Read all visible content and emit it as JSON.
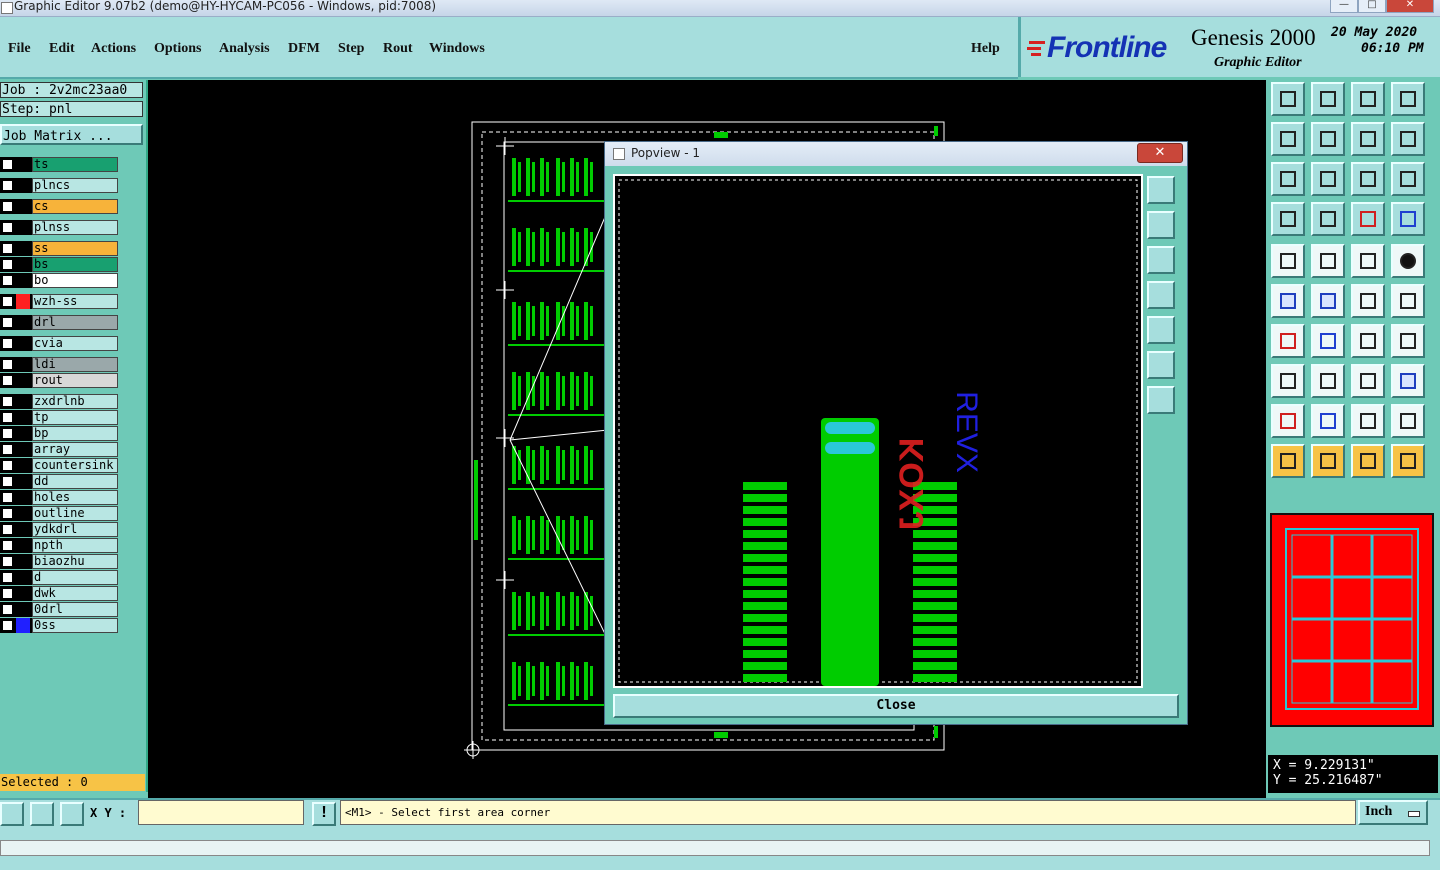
{
  "window": {
    "title": "Graphic Editor 9.07b2 (demo@HY-HYCAM-PC056 - Windows, pid:7008)",
    "min": "—",
    "max": "□",
    "close": "✕"
  },
  "menu": [
    "File",
    "Edit",
    "Actions",
    "Options",
    "Analysis",
    "DFM",
    "Step",
    "Rout",
    "Windows"
  ],
  "help": "Help",
  "brand": {
    "logo": "Frontline",
    "product": "Genesis 2000",
    "subtitle": "Graphic Editor",
    "date": "20 May 2020",
    "time": "06:10 PM"
  },
  "job": {
    "job_line": "Job : 2v2mc23aa0",
    "step_line": "Step: pnl",
    "matrix_button": "Job Matrix ..."
  },
  "layers": [
    {
      "name": "ts",
      "color": "#18a070"
    },
    {
      "name": "plncs",
      "color": "#b8e6e3"
    },
    {
      "name": "cs",
      "color": "#f7b33a"
    },
    {
      "name": "plnss",
      "color": "#b8e6e3"
    },
    {
      "name": "ss",
      "color": "#f7b33a"
    },
    {
      "name": "bs",
      "color": "#18a070"
    },
    {
      "name": "bo",
      "color": "#ffffff"
    },
    {
      "name": "wzh-ss",
      "color": "#b8e6e3"
    },
    {
      "name": "drl",
      "color": "#9aa8aa"
    },
    {
      "name": "cvia",
      "color": "#b8e6e3"
    },
    {
      "name": "ldi",
      "color": "#9aa8aa"
    },
    {
      "name": "rout",
      "color": "#d8d8d8"
    },
    {
      "name": "zxdrlnb",
      "color": "#b8e6e3"
    },
    {
      "name": "tp",
      "color": "#b8e6e3"
    },
    {
      "name": "bp",
      "color": "#b8e6e3"
    },
    {
      "name": "array",
      "color": "#b8e6e3"
    },
    {
      "name": "countersink",
      "color": "#b8e6e3"
    },
    {
      "name": "dd",
      "color": "#b8e6e3"
    },
    {
      "name": "holes",
      "color": "#b8e6e3"
    },
    {
      "name": "outline",
      "color": "#b8e6e3"
    },
    {
      "name": "ydkdrl",
      "color": "#b8e6e3"
    },
    {
      "name": "npth",
      "color": "#b8e6e3"
    },
    {
      "name": "biaozhu",
      "color": "#b8e6e3"
    },
    {
      "name": "d",
      "color": "#b8e6e3"
    },
    {
      "name": "dwk",
      "color": "#b8e6e3"
    },
    {
      "name": "0drl",
      "color": "#b8e6e3"
    },
    {
      "name": "0ss",
      "color": "#b8e6e3"
    }
  ],
  "selected": "Selected : 0",
  "popup": {
    "title": "Popview - 1",
    "close_x": "✕",
    "close_button": "Close",
    "text_red": "KOXJ",
    "text_blue": "REVX"
  },
  "coords": {
    "x": "X = 9.229131\"",
    "y": "Y = 25.216487\""
  },
  "status": {
    "xy_label": "X Y :",
    "xy_value": "",
    "prompt": "<M1> - Select first area corner",
    "unit": "Inch"
  },
  "colors": {
    "panel": "#6ec9b7",
    "menu": "#a6dedd",
    "accent_orange": "#f7c346",
    "copper_green": "#00cc00",
    "minimap_red": "#ff0000"
  }
}
